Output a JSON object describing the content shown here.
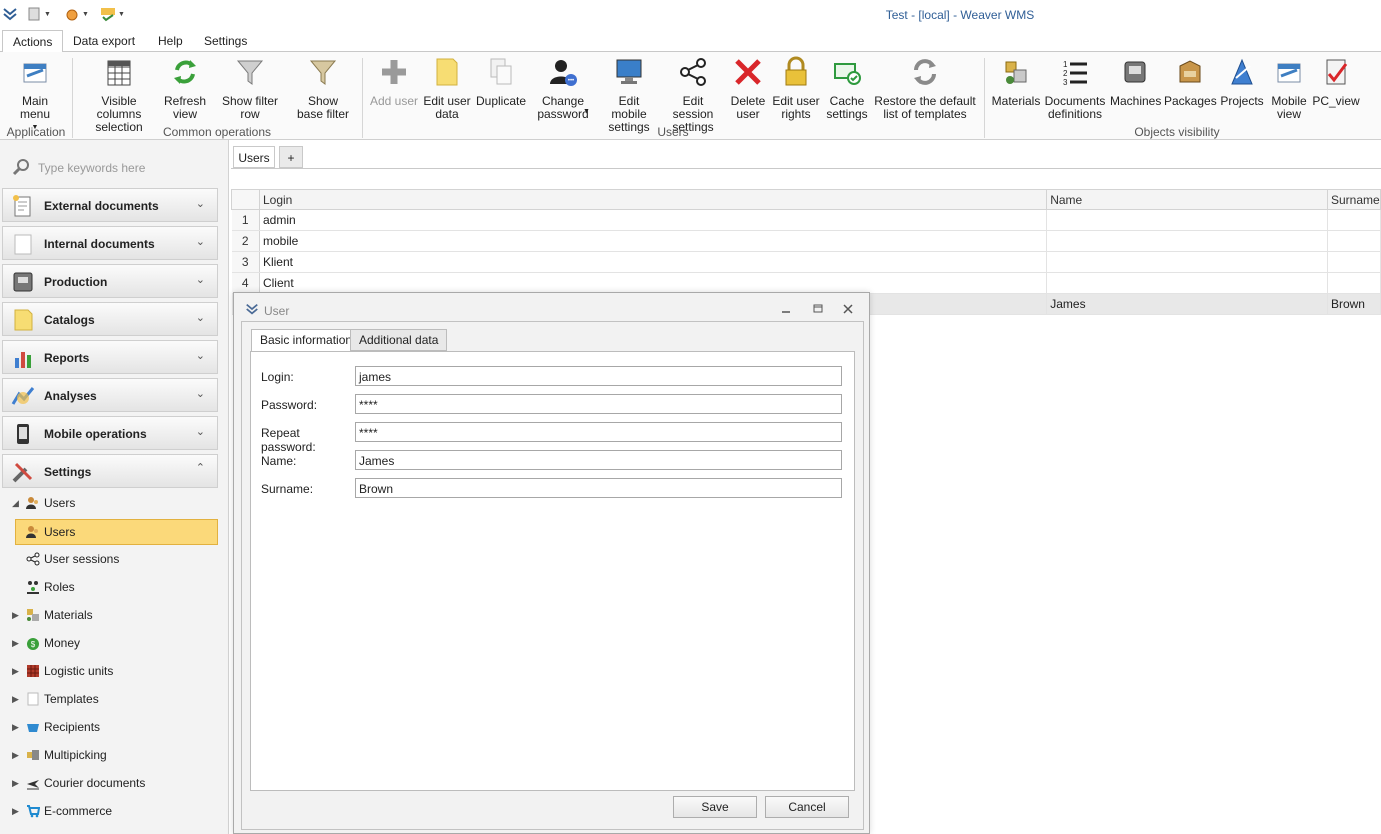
{
  "window": {
    "title": "Test - [local] - Weaver WMS"
  },
  "ribbon_tabs": [
    "Actions",
    "Data export",
    "Help",
    "Settings"
  ],
  "ribbon": {
    "main_menu": "Main menu",
    "application": "Application",
    "visible_columns": "Visible columns selection",
    "refresh_view": "Refresh view",
    "show_filter_row": "Show filter row",
    "show_base_filter": "Show base filter",
    "common_operations": "Common operations",
    "add_user": "Add user",
    "edit_user_data": "Edit user data",
    "duplicate": "Duplicate",
    "change_password": "Change password",
    "edit_mobile_settings": "Edit mobile settings",
    "edit_session_settings": "Edit session settings",
    "delete_user": "Delete user",
    "edit_user_rights": "Edit user rights",
    "cache_settings": "Cache settings",
    "restore_templates": "Restore the default list of templates",
    "users_group": "Users",
    "materials": "Materials",
    "documents_definitions": "Documents definitions",
    "machines": "Machines",
    "packages": "Packages",
    "projects": "Projects",
    "mobile_view": "Mobile view",
    "pc_view": "PC_view",
    "objects_visibility": "Objects visibility"
  },
  "sidebar": {
    "search_placeholder": "Type keywords here",
    "nav": [
      "External documents",
      "Internal documents",
      "Production",
      "Catalogs",
      "Reports",
      "Analyses",
      "Mobile operations",
      "Settings"
    ],
    "tree": [
      "Users",
      "Users",
      "User sessions",
      "Roles",
      "Materials",
      "Money",
      "Logistic units",
      "Templates",
      "Recipients",
      "Multipicking",
      "Courier documents",
      "E-commerce"
    ]
  },
  "doc_tabs": [
    "Users",
    "+"
  ],
  "grid": {
    "columns": [
      "Login",
      "Name",
      "Surname"
    ],
    "rows": [
      {
        "num": "1",
        "login": "admin",
        "name": "",
        "surname": ""
      },
      {
        "num": "2",
        "login": "mobile",
        "name": "",
        "surname": ""
      },
      {
        "num": "3",
        "login": "Klient",
        "name": "",
        "surname": ""
      },
      {
        "num": "4",
        "login": "Client",
        "name": "",
        "surname": ""
      },
      {
        "num": "",
        "login": "",
        "name": "James",
        "surname": "Brown"
      }
    ]
  },
  "dialog": {
    "title": "User",
    "tabs": [
      "Basic information",
      "Additional data"
    ],
    "fields": [
      {
        "label": "Login:",
        "value": "james"
      },
      {
        "label": "Password:",
        "value": "****"
      },
      {
        "label": "Repeat password:",
        "value": "****"
      },
      {
        "label": "Name:",
        "value": "James"
      },
      {
        "label": "Surname:",
        "value": "Brown"
      }
    ],
    "save": "Save",
    "cancel": "Cancel"
  },
  "colors": {
    "accent_title": "#2f5e96",
    "selection": "#fbd97a"
  }
}
